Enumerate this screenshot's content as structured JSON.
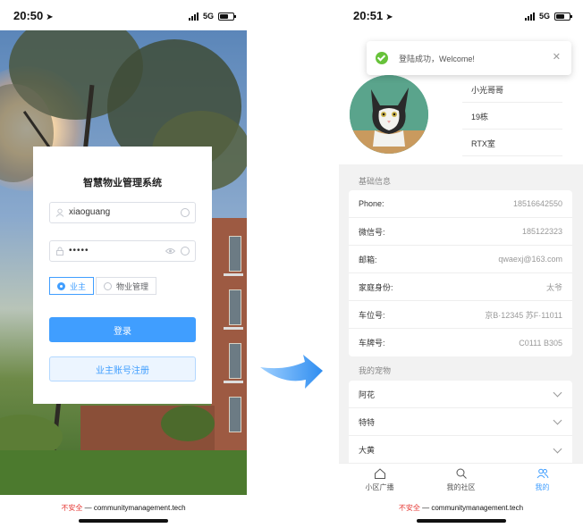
{
  "left": {
    "status": {
      "time": "20:50",
      "network": "5G"
    },
    "login": {
      "title": "智慧物业管理系统",
      "username_value": "xiaoguang",
      "password_value": "•••••",
      "roles": [
        "业主",
        "物业管理"
      ],
      "selected_role": "业主",
      "login_label": "登录",
      "register_label": "业主账号注册"
    },
    "url": {
      "insecure": "不安全",
      "sep": " — ",
      "domain": "communitymanagement.tech"
    }
  },
  "right": {
    "status": {
      "time": "20:51",
      "network": "5G"
    },
    "toast": "登陆成功，Welcome!",
    "profile": {
      "name": "小光哥哥",
      "building": "19栋",
      "room": "RTX室"
    },
    "basic_section": "基础信息",
    "basic_info": [
      {
        "label": "Phone:",
        "value": "18516642550"
      },
      {
        "label": "微信号:",
        "value": "185122323"
      },
      {
        "label": "邮箱:",
        "value": "qwaexj@163.com"
      },
      {
        "label": "家庭身份:",
        "value": "太爷"
      },
      {
        "label": "车位号:",
        "value": "京B·12345 苏F·11011"
      },
      {
        "label": "车牌号:",
        "value": "C0111 B305"
      }
    ],
    "pets_section": "我的宠物",
    "pets": [
      "阿花",
      "特特",
      "大黄"
    ],
    "tabs": [
      "小区广播",
      "我的社区",
      "我的"
    ],
    "active_tab": "我的",
    "url": {
      "insecure": "不安全",
      "sep": " — ",
      "domain": "communitymanagement.tech"
    }
  },
  "colors": {
    "primary": "#409eff",
    "success": "#67c23a",
    "insecure": "#e53935"
  }
}
